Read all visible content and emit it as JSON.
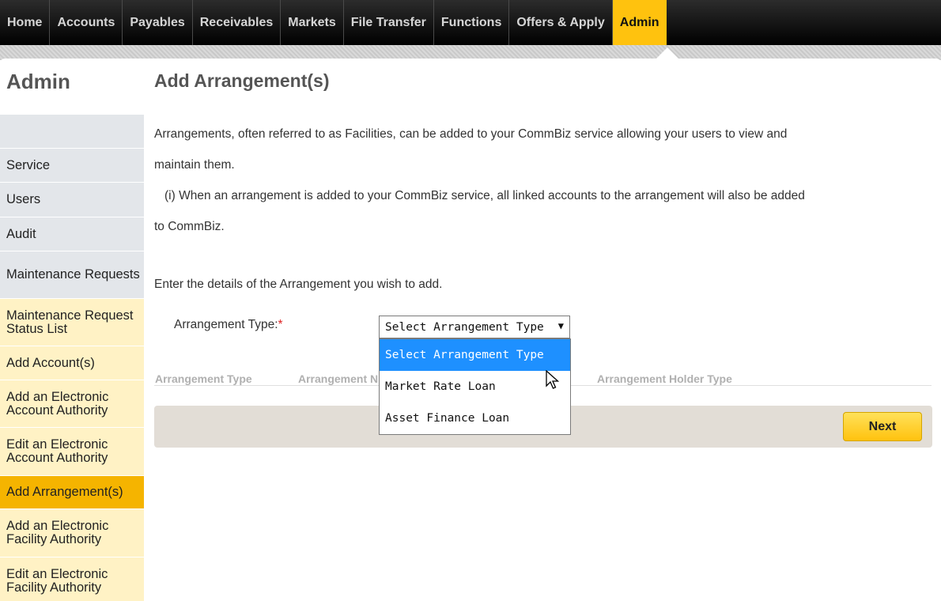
{
  "nav": {
    "items": [
      "Home",
      "Accounts",
      "Payables",
      "Receivables",
      "Markets",
      "File Transfer",
      "Functions",
      "Offers & Apply",
      "Admin"
    ],
    "active": "Admin"
  },
  "sidebar": {
    "title": "Admin",
    "items": [
      {
        "label": "",
        "style": "grey"
      },
      {
        "label": "Service",
        "style": "grey"
      },
      {
        "label": "Users",
        "style": "grey"
      },
      {
        "label": "Audit",
        "style": "grey"
      },
      {
        "label": "Maintenance Requests",
        "style": "grey"
      },
      {
        "label": "Maintenance Request Status List",
        "style": "yellow"
      },
      {
        "label": "Add Account(s)",
        "style": "yellow"
      },
      {
        "label": "Add an Electronic Account Authority",
        "style": "yellow"
      },
      {
        "label": "Edit an Electronic Account Authority",
        "style": "yellow"
      },
      {
        "label": "Add Arrangement(s)",
        "style": "active"
      },
      {
        "label": "Add an Electronic Facility Authority",
        "style": "yellow"
      },
      {
        "label": "Edit an Electronic Facility Authority",
        "style": "yellow"
      }
    ]
  },
  "content": {
    "title": "Add Arrangement(s)",
    "intro_line1": "Arrangements, often referred to as Facilities, can be added to your CommBiz service allowing your users to view and",
    "intro_line2": "maintain them.",
    "info_line1": "(i) When an arrangement is added to your CommBiz service, all linked accounts to the arrangement will also be added",
    "info_line2": "to CommBiz.",
    "instructions": "Enter the details of the Arrangement you wish to add.",
    "field_label": "Arrangement Type:",
    "required_mark": "*"
  },
  "select": {
    "value": "Select Arrangement Type",
    "arrow": "▼",
    "options": [
      "Select Arrangement Type",
      "Market Rate Loan",
      "Asset Finance Loan"
    ],
    "highlighted_index": 0
  },
  "table": {
    "headers": [
      "Arrangement Type",
      "Arrangement N",
      "Arrangement Holder Type"
    ]
  },
  "actions": {
    "next_label": "Next"
  },
  "colors": {
    "accent": "#ffc20e",
    "active_sidebar": "#f5b400",
    "highlight": "#1e90ff"
  }
}
